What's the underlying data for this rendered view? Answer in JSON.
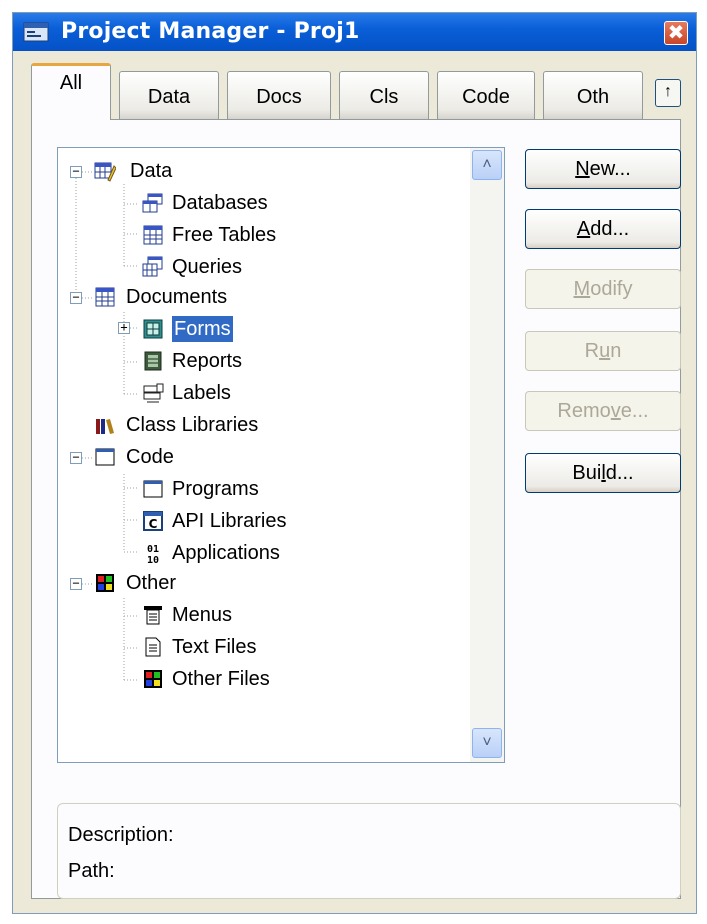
{
  "window": {
    "title": "Project Manager - Proj1",
    "close_glyph": "✖"
  },
  "tabs": [
    {
      "label": "All",
      "active": true
    },
    {
      "label": "Data"
    },
    {
      "label": "Docs"
    },
    {
      "label": "Cls"
    },
    {
      "label": "Code"
    },
    {
      "label": "Oth"
    }
  ],
  "tab_scroll_glyph": "↑",
  "tree": {
    "items": [
      {
        "label": "Data",
        "icon": "data-icon"
      },
      {
        "label": "Databases",
        "icon": "databases-icon"
      },
      {
        "label": "Free Tables",
        "icon": "free-tables-icon"
      },
      {
        "label": "Queries",
        "icon": "queries-icon"
      },
      {
        "label": "Documents",
        "icon": "documents-icon"
      },
      {
        "label": "Forms",
        "icon": "forms-icon",
        "selected": true
      },
      {
        "label": "Reports",
        "icon": "reports-icon"
      },
      {
        "label": "Labels",
        "icon": "labels-icon"
      },
      {
        "label": "Class Libraries",
        "icon": "class-libraries-icon"
      },
      {
        "label": "Code",
        "icon": "code-icon"
      },
      {
        "label": "Programs",
        "icon": "programs-icon"
      },
      {
        "label": "API Libraries",
        "icon": "api-libraries-icon"
      },
      {
        "label": "Applications",
        "icon": "applications-icon"
      },
      {
        "label": "Other",
        "icon": "other-icon"
      },
      {
        "label": "Menus",
        "icon": "menus-icon"
      },
      {
        "label": "Text Files",
        "icon": "text-files-icon"
      },
      {
        "label": "Other Files",
        "icon": "other-files-icon"
      }
    ],
    "expander_minus": "−",
    "expander_plus": "+",
    "scroll_up_glyph": "˄",
    "scroll_down_glyph": "˅"
  },
  "buttons": {
    "new": {
      "pre": "",
      "key": "N",
      "post": "ew...",
      "enabled": true
    },
    "add": {
      "pre": "",
      "key": "A",
      "post": "dd...",
      "enabled": true
    },
    "modify": {
      "pre": "",
      "key": "M",
      "post": "odify",
      "enabled": false
    },
    "run": {
      "pre": "R",
      "key": "u",
      "post": "n",
      "enabled": false
    },
    "remove": {
      "pre": "Remo",
      "key": "v",
      "post": "e...",
      "enabled": false
    },
    "build": {
      "pre": "Bui",
      "key": "l",
      "post": "d...",
      "enabled": true
    }
  },
  "info": {
    "description_label": "Description:",
    "path_label": "Path:"
  },
  "colors": {
    "title_bar": "#0a5fd8",
    "selection": "#316ac5",
    "tab_highlight": "#e8a640"
  }
}
